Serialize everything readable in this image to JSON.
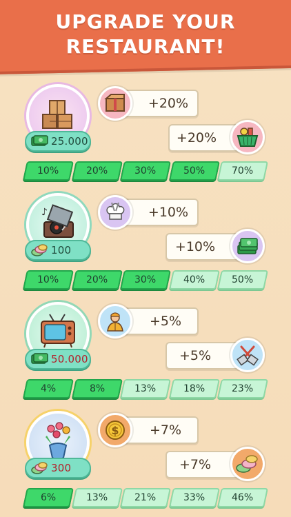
{
  "title_lines": [
    "UPGRADE YOUR",
    "RESTAURANT!"
  ],
  "colors": {
    "header": "#e96f4a",
    "level_active": "#3ed86a",
    "level_inactive": "#c7f5d6",
    "cost_pill": "#7fe0c5"
  },
  "sections": [
    {
      "main_icon": "boxes-icon",
      "cost_icon": "cash-icon",
      "cost": "25.000",
      "bonus_top": {
        "icon": "box-icon",
        "text": "+20%"
      },
      "bonus_bottom": {
        "icon": "grocery-basket-icon",
        "text": "+20%"
      },
      "levels": [
        {
          "label": "10%",
          "active": true
        },
        {
          "label": "20%",
          "active": true
        },
        {
          "label": "30%",
          "active": true
        },
        {
          "label": "50%",
          "active": true
        },
        {
          "label": "70%",
          "active": false
        }
      ]
    },
    {
      "main_icon": "record-player-icon",
      "cost_icon": "macaron-icon",
      "cost": "100",
      "bonus_top": {
        "icon": "chef-hat-icon",
        "text": "+10%"
      },
      "bonus_bottom": {
        "icon": "cash-stack-icon",
        "text": "+10%"
      },
      "levels": [
        {
          "label": "10%",
          "active": true
        },
        {
          "label": "20%",
          "active": true
        },
        {
          "label": "30%",
          "active": true
        },
        {
          "label": "40%",
          "active": false
        },
        {
          "label": "50%",
          "active": false
        }
      ]
    },
    {
      "main_icon": "tv-icon",
      "cost_icon": "cash-icon",
      "cost": "50.000",
      "bonus_top": {
        "icon": "waiter-icon",
        "text": "+5%"
      },
      "bonus_bottom": {
        "icon": "spatulas-icon",
        "text": "+5%"
      },
      "levels": [
        {
          "label": "4%",
          "active": true
        },
        {
          "label": "8%",
          "active": true
        },
        {
          "label": "13%",
          "active": false
        },
        {
          "label": "18%",
          "active": false
        },
        {
          "label": "23%",
          "active": false
        }
      ]
    },
    {
      "main_icon": "flower-vase-icon",
      "cost_icon": "macaron-icon",
      "cost": "300",
      "bonus_top": {
        "icon": "dollar-coin-icon",
        "text": "+7%"
      },
      "bonus_bottom": {
        "icon": "macarons-icon",
        "text": "+7%"
      },
      "levels": [
        {
          "label": "6%",
          "active": true
        },
        {
          "label": "13%",
          "active": false
        },
        {
          "label": "21%",
          "active": false
        },
        {
          "label": "33%",
          "active": false
        },
        {
          "label": "46%",
          "active": false
        }
      ]
    }
  ]
}
